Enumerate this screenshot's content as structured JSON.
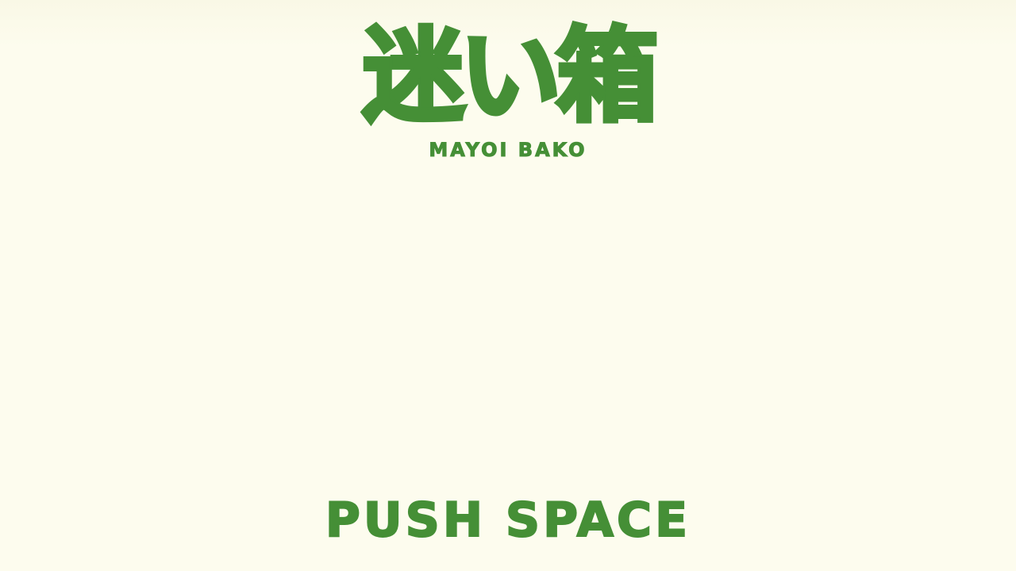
{
  "title": {
    "logo_text": "迷い箱",
    "romaji": "MAYOI BAKO"
  },
  "prompt": {
    "label": "PUSH SPACE"
  },
  "colors": {
    "background": "#fdfcee",
    "accent": "#458f36"
  }
}
